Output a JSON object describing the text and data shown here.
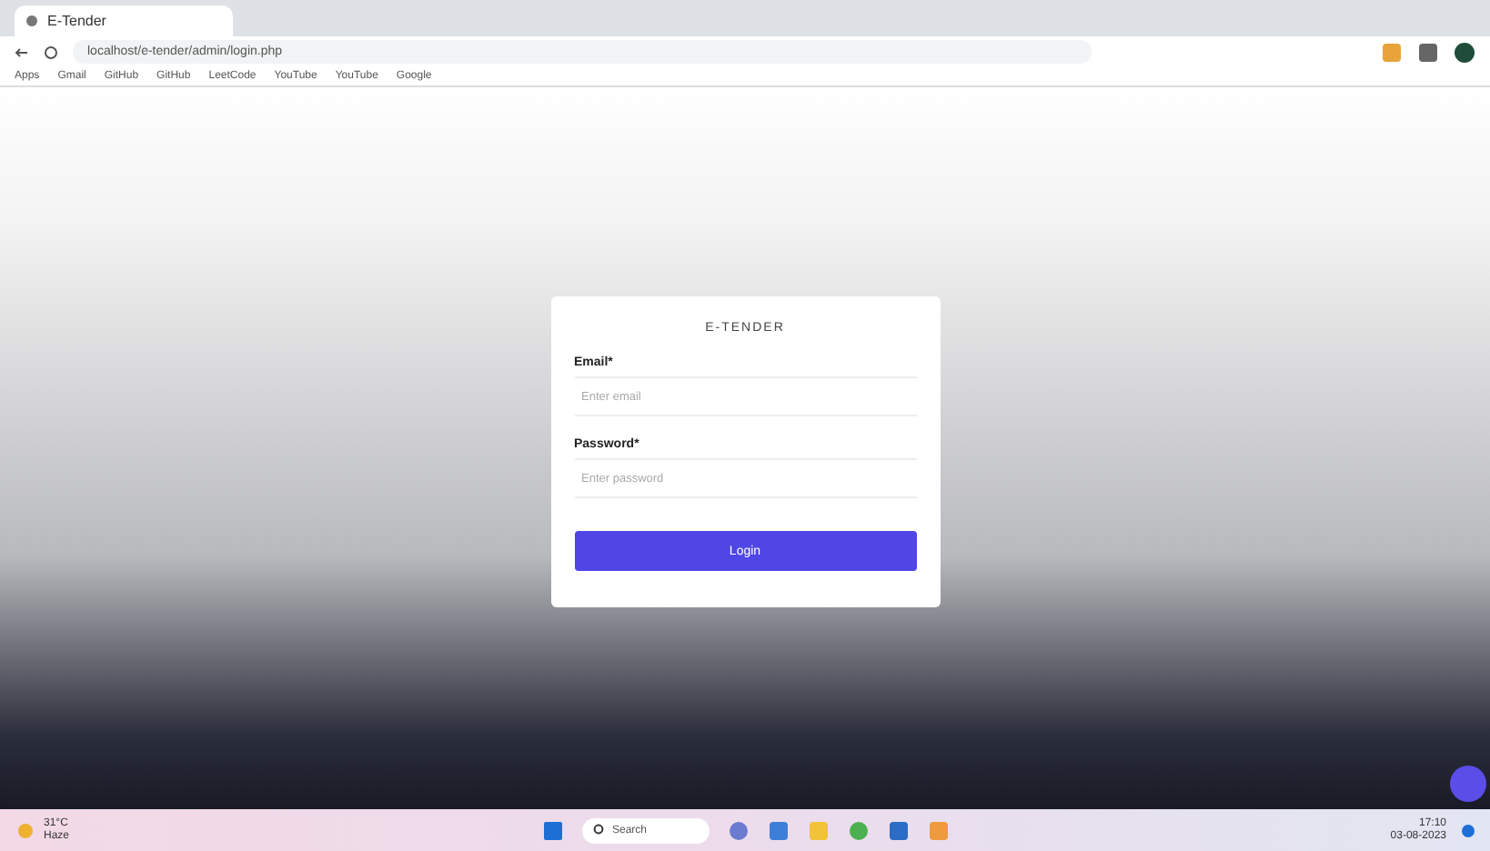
{
  "browser": {
    "tab_title": "E-Tender",
    "url": "localhost/e-tender/admin/login.php",
    "bookmarks": [
      "Apps",
      "Gmail",
      "GitHub",
      "GitHub",
      "LeetCode",
      "YouTube",
      "YouTube",
      "Google"
    ]
  },
  "login": {
    "title": "E-TENDER",
    "fields": [
      {
        "label": "Email*",
        "placeholder": "Enter email"
      },
      {
        "label": "Password*",
        "placeholder": "Enter password"
      }
    ],
    "button": "Login"
  },
  "taskbar": {
    "weather_temp": "31°C",
    "weather_text": "Haze",
    "search": "Search",
    "time": "17:10",
    "date": "03-08-2023"
  }
}
